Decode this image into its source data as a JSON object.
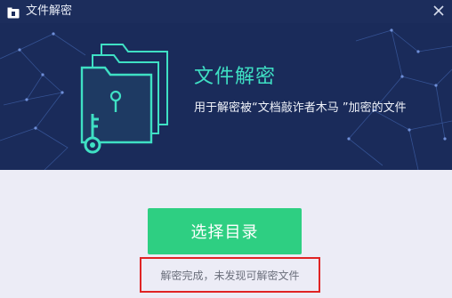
{
  "window": {
    "title": "文件解密"
  },
  "banner": {
    "title": "文件解密",
    "subtitle": "用于解密被“文档敲诈者木马 ”加密的文件"
  },
  "main": {
    "select_button_label": "选择目录",
    "status_text": "解密完成，未发现可解密文件"
  },
  "colors": {
    "titlebar_bg": "#1c2d5c",
    "banner_bg": "#1a2b5a",
    "accent_teal": "#3fe0c4",
    "button_green": "#2ecf82",
    "highlight_red": "#e02424",
    "content_bg": "#ececf6"
  },
  "icons": {
    "titlebar": "folder-lock-icon",
    "close": "close-icon",
    "banner": "locked-folder-key-icon"
  }
}
